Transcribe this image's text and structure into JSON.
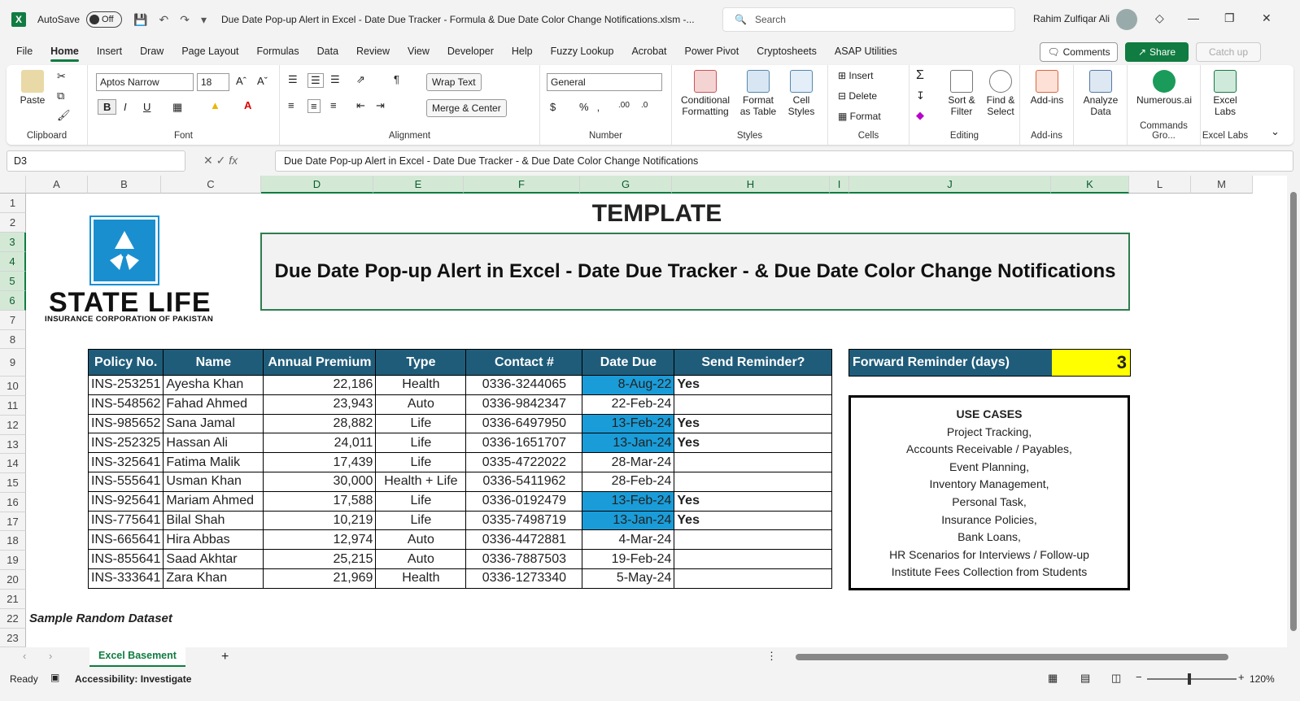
{
  "window": {
    "autosave_label": "AutoSave",
    "autosave_state": "Off",
    "title": "Due Date Pop-up Alert in Excel - Date Due Tracker - Formula & Due Date Color Change Notifications.xlsm  -...",
    "search_placeholder": "Search",
    "user": "Rahim Zulfiqar Ali"
  },
  "menu": {
    "tabs": [
      "File",
      "Home",
      "Insert",
      "Draw",
      "Page Layout",
      "Formulas",
      "Data",
      "Review",
      "View",
      "Developer",
      "Help",
      "Fuzzy Lookup",
      "Acrobat",
      "Power Pivot",
      "Cryptosheets",
      "ASAP Utilities"
    ],
    "comments": "Comments",
    "share": "Share",
    "catchup": "Catch up"
  },
  "ribbon": {
    "clipboard": {
      "paste": "Paste",
      "label": "Clipboard"
    },
    "font": {
      "name": "Aptos Narrow",
      "size": "18",
      "label": "Font"
    },
    "alignment": {
      "wrap": "Wrap Text",
      "merge": "Merge & Center",
      "label": "Alignment"
    },
    "number": {
      "format": "General",
      "label": "Number"
    },
    "styles": {
      "conditional": "Conditional Formatting",
      "format_table": "Format as Table",
      "cell_styles": "Cell Styles",
      "label": "Styles"
    },
    "cells": {
      "insert": "Insert",
      "delete": "Delete",
      "format": "Format",
      "label": "Cells"
    },
    "editing": {
      "sort": "Sort & Filter",
      "find": "Find & Select",
      "label": "Editing"
    },
    "addins": {
      "addins": "Add-ins",
      "label": "Add-ins"
    },
    "analyze": {
      "analyze": "Analyze Data"
    },
    "numerous": {
      "name": "Numerous.ai",
      "label": "Commands Gro..."
    },
    "labs": {
      "name": "Excel Labs",
      "label": "Excel Labs"
    }
  },
  "formula_bar": {
    "cell_ref": "D3",
    "formula": "Due Date Pop-up Alert in Excel - Date Due Tracker - & Due Date Color Change Notifications"
  },
  "columns": [
    "A",
    "B",
    "C",
    "D",
    "E",
    "F",
    "G",
    "H",
    "I",
    "J",
    "K",
    "L",
    "M"
  ],
  "rows": [
    "1",
    "2",
    "3",
    "4",
    "5",
    "6",
    "7",
    "8",
    "9",
    "10",
    "11",
    "12",
    "13",
    "14",
    "15",
    "16",
    "17",
    "18",
    "19",
    "20",
    "21",
    "22",
    "23"
  ],
  "logo": {
    "main": "STATE LIFE",
    "sub": "INSURANCE CORPORATION OF PAKISTAN"
  },
  "sheet": {
    "template_title": "TEMPLATE",
    "banner": "Due Date Pop-up Alert in Excel - Date Due Tracker - & Due Date Color Change Notifications",
    "headers": [
      "Policy No.",
      "Name",
      "Annual Premium",
      "Type",
      "Contact #",
      "Date Due",
      "Send Reminder?"
    ],
    "records": [
      {
        "policy": "INS-253251",
        "name": "Ayesha Khan",
        "premium": "22,186",
        "type": "Health",
        "contact": "0336-3244065",
        "due": "8-Aug-22",
        "reminder": "Yes",
        "highlight": true
      },
      {
        "policy": "INS-548562",
        "name": "Fahad Ahmed",
        "premium": "23,943",
        "type": "Auto",
        "contact": "0336-9842347",
        "due": "22-Feb-24",
        "reminder": "",
        "highlight": false
      },
      {
        "policy": "INS-985652",
        "name": "Sana Jamal",
        "premium": "28,882",
        "type": "Life",
        "contact": "0336-6497950",
        "due": "13-Feb-24",
        "reminder": "Yes",
        "highlight": true
      },
      {
        "policy": "INS-252325",
        "name": "Hassan Ali",
        "premium": "24,011",
        "type": "Life",
        "contact": "0336-1651707",
        "due": "13-Jan-24",
        "reminder": "Yes",
        "highlight": true
      },
      {
        "policy": "INS-325641",
        "name": "Fatima Malik",
        "premium": "17,439",
        "type": "Life",
        "contact": "0335-4722022",
        "due": "28-Mar-24",
        "reminder": "",
        "highlight": false
      },
      {
        "policy": "INS-555641",
        "name": "Usman Khan",
        "premium": "30,000",
        "type": "Health + Life",
        "contact": "0336-5411962",
        "due": "28-Feb-24",
        "reminder": "",
        "highlight": false
      },
      {
        "policy": "INS-925641",
        "name": "Mariam Ahmed",
        "premium": "17,588",
        "type": "Life",
        "contact": "0336-0192479",
        "due": "13-Feb-24",
        "reminder": "Yes",
        "highlight": true
      },
      {
        "policy": "INS-775641",
        "name": "Bilal Shah",
        "premium": "10,219",
        "type": "Life",
        "contact": "0335-7498719",
        "due": "13-Jan-24",
        "reminder": "Yes",
        "highlight": true
      },
      {
        "policy": "INS-665641",
        "name": "Hira Abbas",
        "premium": "12,974",
        "type": "Auto",
        "contact": "0336-4472881",
        "due": "4-Mar-24",
        "reminder": "",
        "highlight": false
      },
      {
        "policy": "INS-855641",
        "name": "Saad Akhtar",
        "premium": "25,215",
        "type": "Auto",
        "contact": "0336-7887503",
        "due": "19-Feb-24",
        "reminder": "",
        "highlight": false
      },
      {
        "policy": "INS-333641",
        "name": "Zara Khan",
        "premium": "21,969",
        "type": "Health",
        "contact": "0336-1273340",
        "due": "5-May-24",
        "reminder": "",
        "highlight": false
      }
    ],
    "forward_label": "Forward Reminder (days)",
    "forward_value": "3",
    "usecases_title": "USE CASES",
    "usecases": [
      "Project Tracking,",
      "Accounts Receivable / Payables,",
      "Event Planning,",
      "Inventory Management,",
      "Personal Task,",
      "Insurance Policies,",
      "Bank Loans,",
      "HR Scenarios for Interviews / Follow-up",
      "Institute Fees Collection from Students"
    ],
    "sample_label": "Sample Random Dataset"
  },
  "sheet_tabs": [
    "Excel Basement"
  ],
  "status": {
    "ready": "Ready",
    "accessibility": "Accessibility: Investigate",
    "zoom": "120%"
  },
  "colors": {
    "accent": "#107c41",
    "header_blue": "#1f5c7a",
    "due_highlight": "#1a9cd8",
    "forward_yellow": "#ffff00"
  }
}
